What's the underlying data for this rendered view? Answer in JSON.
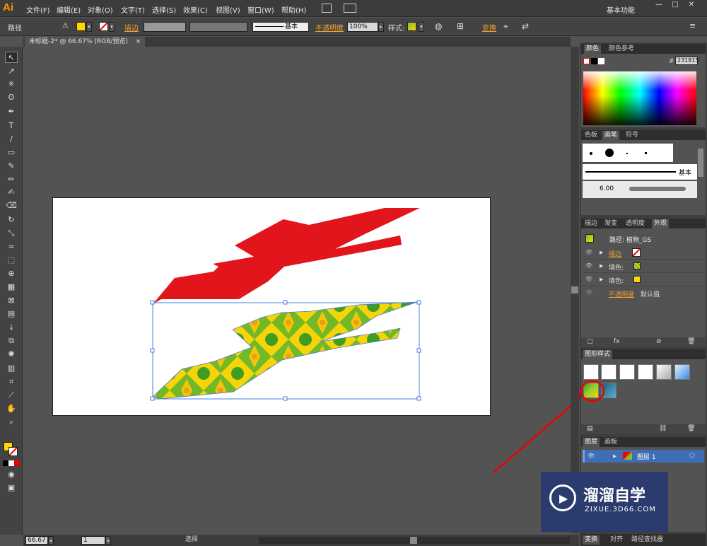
{
  "app": {
    "logo": "Ai",
    "workspace": "基本功能"
  },
  "menu": [
    "文件(F)",
    "编辑(E)",
    "对象(O)",
    "文字(T)",
    "选择(S)",
    "效果(C)",
    "视图(V)",
    "窗口(W)",
    "帮助(H)"
  ],
  "control": {
    "object_type": "路径",
    "stroke_label": "描边",
    "stroke_style": "基本",
    "opacity_label": "不透明度",
    "opacity_value": "100%",
    "style_label": "样式:",
    "transform_label": "变换",
    "fill_color": "#ffd800"
  },
  "document": {
    "tab_title": "未标题-2* @ 66.67% (RGB/预览)",
    "close": "×"
  },
  "status": {
    "zoom": "66.67",
    "artboard": "1",
    "mode": "选择"
  },
  "panels": {
    "color": {
      "tabs": [
        "颜色",
        "颜色参考"
      ],
      "hex_prefix": "#",
      "hex_value": "231815"
    },
    "brush": {
      "tabs": [
        "色板",
        "画笔",
        "符号"
      ],
      "basic_label": "基本",
      "size": "6.00"
    },
    "appearance": {
      "tabs": [
        "描边",
        "渐变",
        "透明度",
        "外观"
      ],
      "path_label": "路径: 植物_GS",
      "rows": [
        {
          "label": "描边",
          "color": "none"
        },
        {
          "label": "填色:",
          "color": "pattern"
        },
        {
          "label": "填色:",
          "color": "#ffd800"
        }
      ],
      "opacity_label": "不透明度",
      "opacity_value": "默认值"
    },
    "graphic_styles": {
      "title": "图形样式"
    },
    "layers": {
      "tabs": [
        "图层",
        "画板"
      ],
      "layer_name": "图层 1"
    },
    "bottom": {
      "tabs": [
        "变换",
        "对齐",
        "路径查找器"
      ]
    }
  },
  "watermark": {
    "brand": "溜溜自学",
    "url": "ZIXUE.3D66.COM"
  }
}
